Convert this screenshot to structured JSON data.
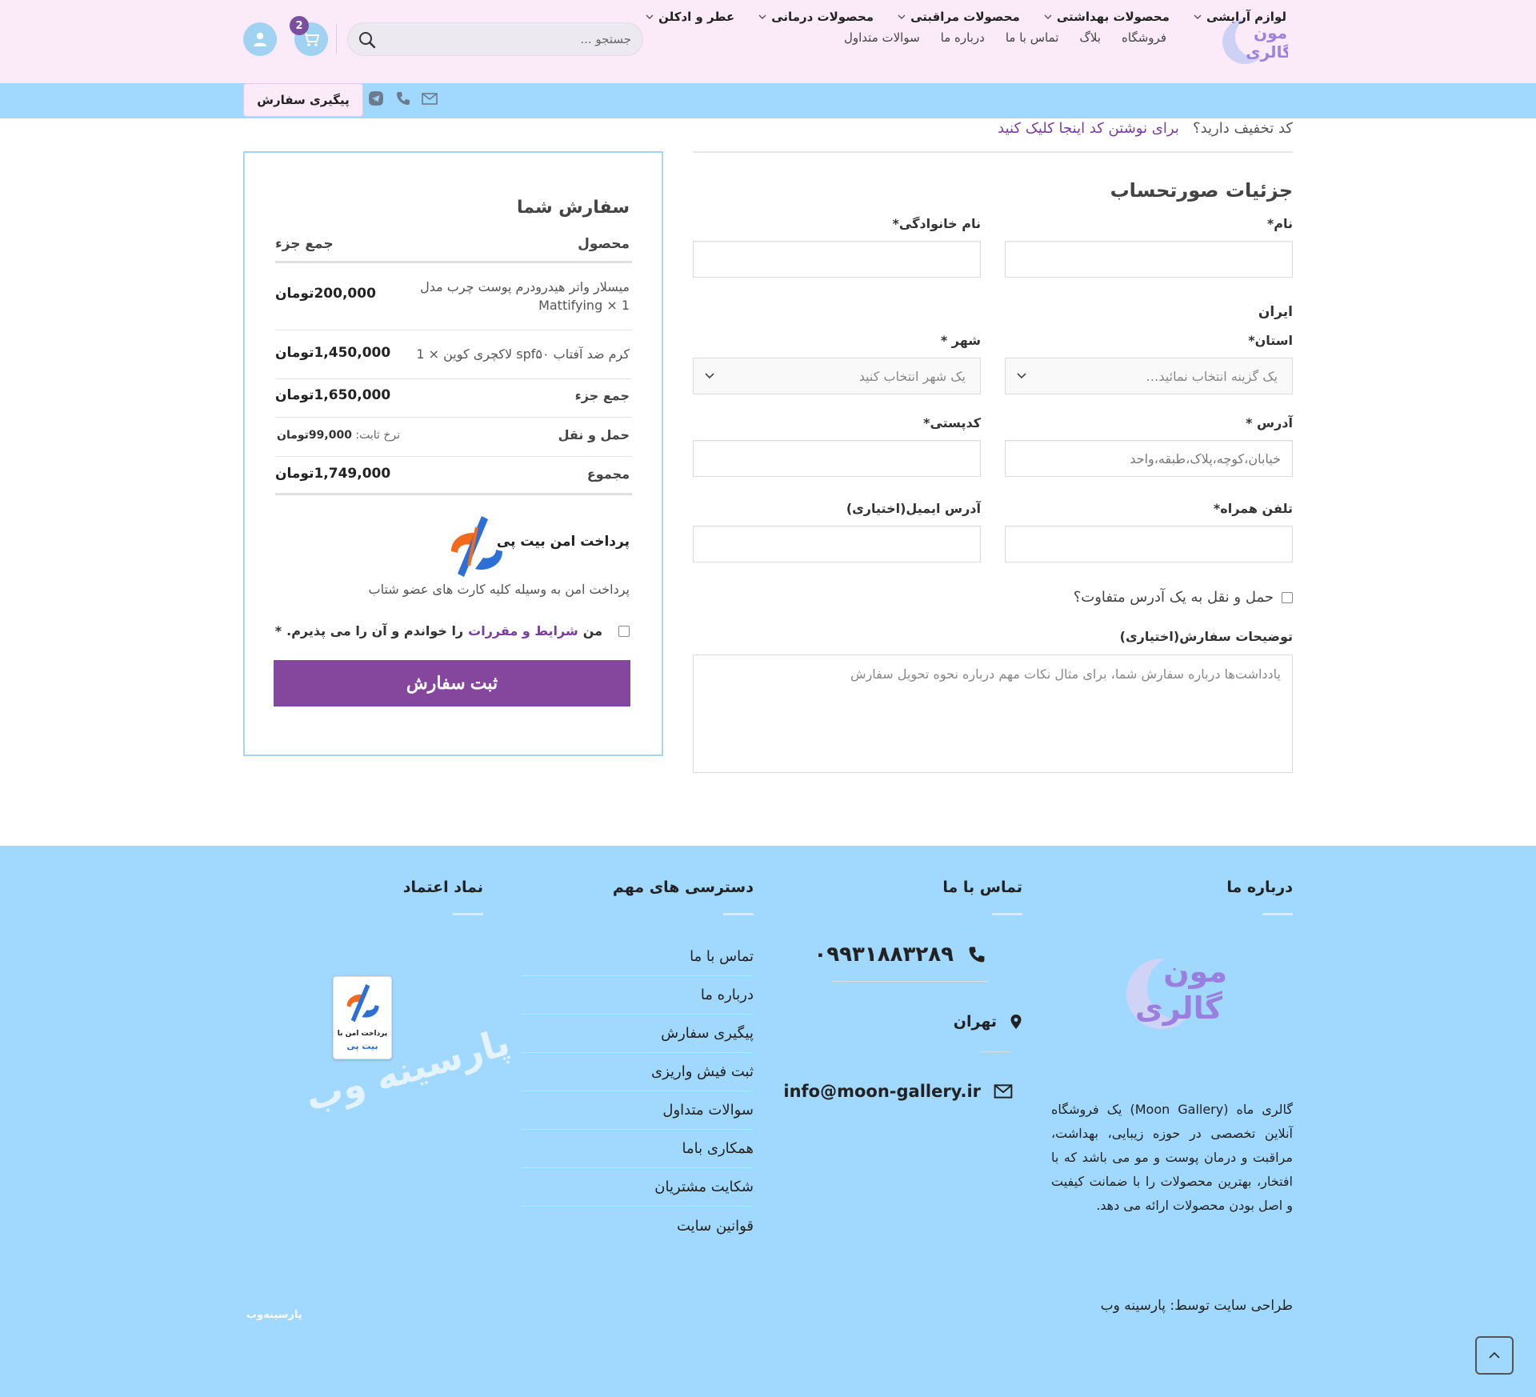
{
  "header": {
    "nav": [
      "فروشگاه",
      "بلاگ",
      "تماس با ما",
      "درباره ما",
      "سوالات متداول"
    ],
    "search_placeholder": "جستجو ...",
    "cart_count": "2"
  },
  "categories": [
    "لوازم آرایشی",
    "محصولات بهداشتی",
    "محصولات مراقبتی",
    "محصولات درمانی",
    "عطر و ادکلن"
  ],
  "track_order": "پیگیری سفارش",
  "coupon": {
    "question": "کد تخفیف دارید؟",
    "link": "برای نوشتن کد اینجا کلیک کنید"
  },
  "billing": {
    "title": "جزئیات صورتحساب",
    "first_name": "نام*",
    "last_name": "نام خانوادگی*",
    "country": "ایران",
    "state": "استان*",
    "state_placeholder": "یک گزینه انتخاب نمائید…",
    "city": "شهر *",
    "city_placeholder": "یک شهر انتخاب کنید",
    "address": "آدرس *",
    "address_placeholder": "خیابان،کوچه،پلاک،طبقه،واحد",
    "postcode": "کدپستی*",
    "phone": "تلفن همراه*",
    "email": "آدرس ایمیل(اختیاری)",
    "ship_different": "حمل و نقل به یک آدرس متفاوت؟",
    "notes_label": "توضیحات سفارش(اختیاری)",
    "notes_placeholder": "یادداشت‌ها درباره سفارش شما، برای مثال نکات مهم درباره نحوه تحویل سفارش"
  },
  "order": {
    "title": "سفارش شما",
    "col_product": "محصول",
    "col_subtotal": "جمع جزء",
    "items": [
      {
        "name": "میسلار واتر هیدرودرم پوست چرب مدل Mattifying",
        "qty": "× 1",
        "price": "200,000تومان"
      },
      {
        "name": "کرم ضد آفتاب spf۵۰ لاکچری کوین",
        "qty": "× 1",
        "price": "1,450,000تومان"
      }
    ],
    "subtotal_label": "جمع جزء",
    "subtotal": "1,650,000تومان",
    "shipping_label": "حمل و نقل",
    "shipping_prefix": "نرخ ثابت:",
    "shipping_value": "99,000تومان",
    "total_label": "مجموع",
    "total": "1,749,000تومان",
    "payment_title": "پرداخت امن بیت پی",
    "payment_desc": "پرداخت امن به وسیله کلیه کارت های عضو شتاب",
    "terms_pre": "من",
    "terms_link": "شرایط و مقررات",
    "terms_post": "را خواندم و آن را می پذیرم.",
    "terms_star": "*",
    "place_order": "ثبت سفارش"
  },
  "footer": {
    "about_title": "درباره ما",
    "contact_title": "تماس با ما",
    "links_title": "دسترسی های مهم",
    "trust_title": "نماد اعتماد",
    "logo_line1": "مون",
    "logo_line2": "گالری",
    "about_text": "گالری ماه (Moon Gallery) یک فروشگاه آنلاین تخصصی در حوزه زیبایی، بهداشت، مراقبت و درمان پوست و مو می باشد که با افتخار، بهترین محصولات را با ضمانت کیفیت و اصل بودن محصولات ارائه می دهد.",
    "phone": "۰۹۹۳۱۸۸۳۲۸۹",
    "city": "تهران",
    "email": "info@moon-gallery.ir",
    "links": [
      "تماس با ما",
      "درباره ما",
      "پیگیری سفارش",
      "ثبت فیش واریزی",
      "سوالات متداول",
      "همکاری باما",
      "شکایت مشتریان",
      "قوانین سایت"
    ],
    "trust_line1": "پرداخت امن با",
    "trust_line2": "بیت پی",
    "credit": "طراحی سایت توسط: پارسینه وب",
    "watermark": "پارسینه وب",
    "brand_small": "پارسینه‌وب"
  },
  "colors": {
    "header_bg": "#fbeaf8",
    "nav_bg": "#a1d8fd",
    "accent": "#84479d",
    "footer_bg": "#a1d8fd"
  }
}
